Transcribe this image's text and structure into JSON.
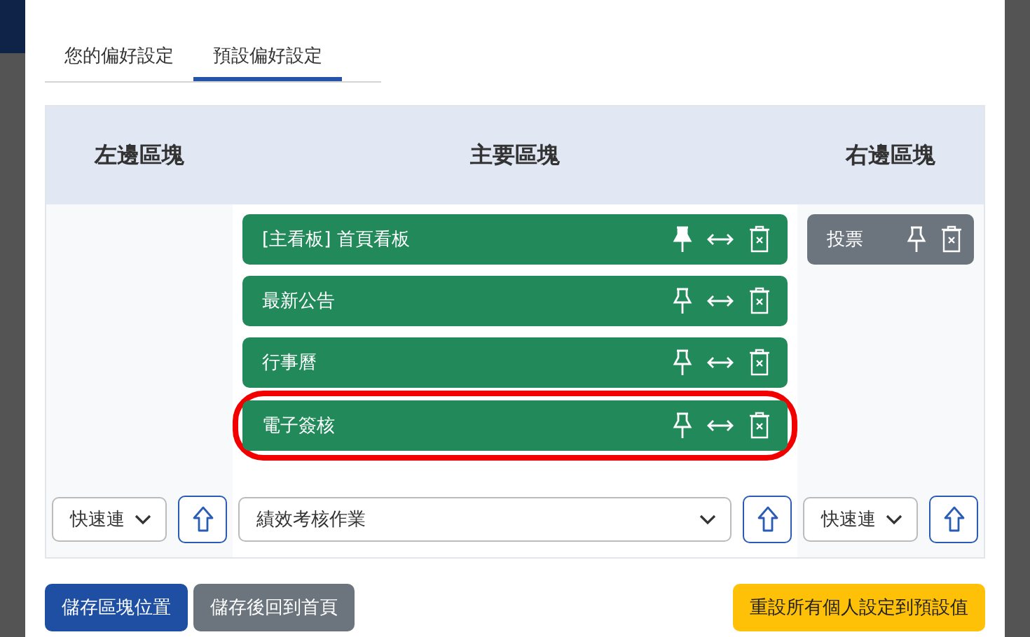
{
  "tabs": [
    {
      "label": "您的偏好設定",
      "selected": false
    },
    {
      "label": "預設偏好設定",
      "selected": true
    }
  ],
  "columns": [
    {
      "title": "左邊區塊",
      "kind": "side",
      "select": "快速連"
    },
    {
      "title": "主要區塊",
      "kind": "main",
      "blocks": [
        {
          "label": "[主看板] 首頁看板",
          "pinned": true,
          "movable": true,
          "highlighted": false,
          "color": "#22895a"
        },
        {
          "label": "最新公告",
          "pinned": false,
          "movable": true,
          "highlighted": false,
          "color": "#22895a"
        },
        {
          "label": "行事曆",
          "pinned": false,
          "movable": true,
          "highlighted": false,
          "color": "#22895a"
        },
        {
          "label": "電子簽核",
          "pinned": false,
          "movable": true,
          "highlighted": true,
          "color": "#22895a"
        }
      ],
      "select": "績效考核作業"
    },
    {
      "title": "右邊區塊",
      "kind": "side",
      "blocks": [
        {
          "label": "投票",
          "pinned": false,
          "movable": false,
          "highlighted": false,
          "color": "#6c757d"
        }
      ],
      "select": "快速連"
    }
  ],
  "buttons": [
    {
      "label": "儲存區塊位置",
      "kind": "primary"
    },
    {
      "label": "儲存後回到首頁",
      "kind": "secondary"
    },
    {
      "label": "重設所有個人設定到預設值",
      "kind": "warning"
    }
  ]
}
